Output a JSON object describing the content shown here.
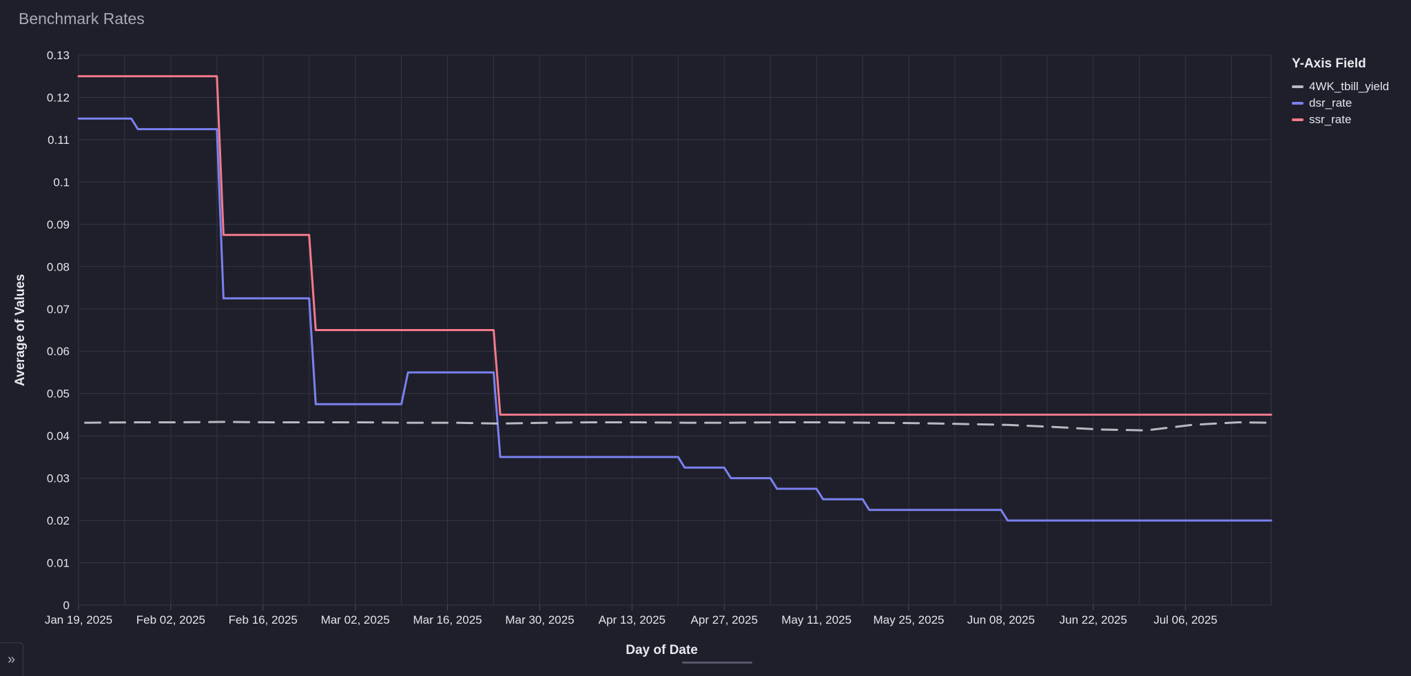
{
  "title": "Benchmark Rates",
  "legend": {
    "title": "Y-Axis Field",
    "items": [
      {
        "label": "4WK_tbill_yield",
        "color": "#b9b9c2"
      },
      {
        "label": "dsr_rate",
        "color": "#7a82f0"
      },
      {
        "label": "ssr_rate",
        "color": "#f57a8c"
      }
    ]
  },
  "expand_icon": "double-chevron-right-icon",
  "expand_glyph": "»",
  "chart_data": {
    "type": "line",
    "title": "Benchmark Rates",
    "xlabel": "Day of Date",
    "ylabel": "Average of Values",
    "ylim": [
      0,
      0.13
    ],
    "xlim": [
      "2025-01-19",
      "2025-07-19"
    ],
    "yticks": [
      0,
      0.01,
      0.02,
      0.03,
      0.04,
      0.05,
      0.06,
      0.07,
      0.08,
      0.09,
      0.1,
      0.11,
      0.12,
      0.13
    ],
    "ytick_labels": [
      "0",
      "0.01",
      "0.02",
      "0.03",
      "0.04",
      "0.05",
      "0.06",
      "0.07",
      "0.08",
      "0.09",
      "0.1",
      "0.11",
      "0.12",
      "0.13"
    ],
    "xticks": [
      {
        "date": "2025-01-19",
        "label": "Jan 19, 2025"
      },
      {
        "date": "2025-02-02",
        "label": "Feb 02, 2025"
      },
      {
        "date": "2025-02-16",
        "label": "Feb 16, 2025"
      },
      {
        "date": "2025-03-02",
        "label": "Mar 02, 2025"
      },
      {
        "date": "2025-03-16",
        "label": "Mar 16, 2025"
      },
      {
        "date": "2025-03-30",
        "label": "Mar 30, 2025"
      },
      {
        "date": "2025-04-13",
        "label": "Apr 13, 2025"
      },
      {
        "date": "2025-04-27",
        "label": "Apr 27, 2025"
      },
      {
        "date": "2025-05-11",
        "label": "May 11, 2025"
      },
      {
        "date": "2025-05-25",
        "label": "May 25, 2025"
      },
      {
        "date": "2025-06-08",
        "label": "Jun 08, 2025"
      },
      {
        "date": "2025-06-22",
        "label": "Jun 22, 2025"
      },
      {
        "date": "2025-07-06",
        "label": "Jul 06, 2025"
      }
    ],
    "grid": true,
    "legend_position": "right",
    "series": [
      {
        "name": "ssr_rate",
        "color": "#f57a8c",
        "style": "solid",
        "points": [
          [
            "2025-01-19",
            0.125
          ],
          [
            "2025-02-09",
            0.125
          ],
          [
            "2025-02-10",
            0.0875
          ],
          [
            "2025-02-23",
            0.0875
          ],
          [
            "2025-02-24",
            0.065
          ],
          [
            "2025-03-23",
            0.065
          ],
          [
            "2025-03-24",
            0.045
          ],
          [
            "2025-07-19",
            0.045
          ]
        ]
      },
      {
        "name": "dsr_rate",
        "color": "#7a82f0",
        "style": "solid",
        "points": [
          [
            "2025-01-19",
            0.115
          ],
          [
            "2025-01-27",
            0.115
          ],
          [
            "2025-01-28",
            0.1125
          ],
          [
            "2025-02-09",
            0.1125
          ],
          [
            "2025-02-10",
            0.0725
          ],
          [
            "2025-02-23",
            0.0725
          ],
          [
            "2025-02-24",
            0.0475
          ],
          [
            "2025-03-09",
            0.0475
          ],
          [
            "2025-03-10",
            0.055
          ],
          [
            "2025-03-23",
            0.055
          ],
          [
            "2025-03-24",
            0.035
          ],
          [
            "2025-04-20",
            0.035
          ],
          [
            "2025-04-21",
            0.0325
          ],
          [
            "2025-04-27",
            0.0325
          ],
          [
            "2025-04-28",
            0.03
          ],
          [
            "2025-05-04",
            0.03
          ],
          [
            "2025-05-05",
            0.0275
          ],
          [
            "2025-05-11",
            0.0275
          ],
          [
            "2025-05-12",
            0.025
          ],
          [
            "2025-05-18",
            0.025
          ],
          [
            "2025-05-19",
            0.0225
          ],
          [
            "2025-06-08",
            0.0225
          ],
          [
            "2025-06-09",
            0.02
          ],
          [
            "2025-07-19",
            0.02
          ]
        ]
      },
      {
        "name": "4WK_tbill_yield",
        "color": "#b9b9c2",
        "style": "dashed",
        "points": [
          [
            "2025-01-20",
            0.0431
          ],
          [
            "2025-01-27",
            0.0432
          ],
          [
            "2025-02-03",
            0.0432
          ],
          [
            "2025-02-10",
            0.0433
          ],
          [
            "2025-02-17",
            0.0432
          ],
          [
            "2025-02-24",
            0.0432
          ],
          [
            "2025-03-03",
            0.0432
          ],
          [
            "2025-03-10",
            0.0431
          ],
          [
            "2025-03-17",
            0.0431
          ],
          [
            "2025-03-24",
            0.0429
          ],
          [
            "2025-03-31",
            0.0431
          ],
          [
            "2025-04-07",
            0.0432
          ],
          [
            "2025-04-14",
            0.0432
          ],
          [
            "2025-04-21",
            0.0431
          ],
          [
            "2025-04-28",
            0.0431
          ],
          [
            "2025-05-05",
            0.0432
          ],
          [
            "2025-05-12",
            0.0432
          ],
          [
            "2025-05-19",
            0.0431
          ],
          [
            "2025-05-26",
            0.043
          ],
          [
            "2025-06-02",
            0.0428
          ],
          [
            "2025-06-09",
            0.0426
          ],
          [
            "2025-06-16",
            0.0421
          ],
          [
            "2025-06-23",
            0.0415
          ],
          [
            "2025-06-30",
            0.0413
          ],
          [
            "2025-07-07",
            0.0426
          ],
          [
            "2025-07-14",
            0.0432
          ],
          [
            "2025-07-19",
            0.0431
          ]
        ]
      }
    ]
  }
}
